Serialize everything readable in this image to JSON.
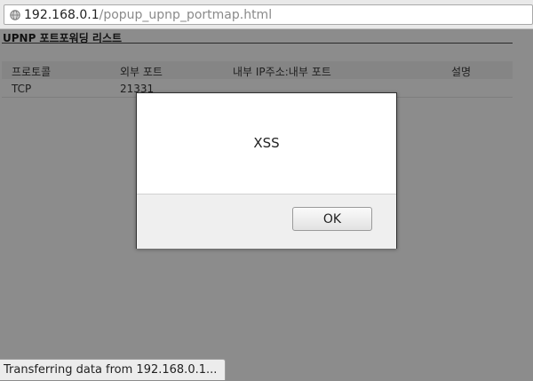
{
  "browser": {
    "url_host": "192.168.0.1",
    "url_path": "/popup_upnp_portmap.html",
    "status_text": "Transferring data from 192.168.0.1..."
  },
  "page": {
    "title": "UPNP 포트포워딩 리스트",
    "table": {
      "headers": [
        "프로토콜",
        "외부 포트",
        "내부 IP주소:내부 포트",
        "설명"
      ],
      "rows": [
        [
          "TCP",
          "21331",
          "",
          ""
        ]
      ]
    }
  },
  "alert": {
    "message": "XSS",
    "ok_label": "OK"
  },
  "icons": {
    "url_icon": "globe-icon"
  }
}
